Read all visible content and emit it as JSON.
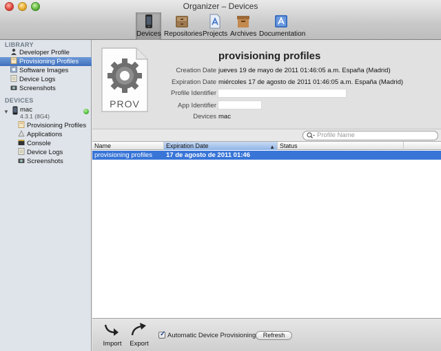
{
  "window": {
    "title": "Organizer – Devices"
  },
  "toolbar": {
    "items": [
      {
        "label": "Devices",
        "icon": "iphone-icon",
        "selected": true
      },
      {
        "label": "Repositories",
        "icon": "repository-icon",
        "selected": false
      },
      {
        "label": "Projects",
        "icon": "projects-icon",
        "selected": false
      },
      {
        "label": "Archives",
        "icon": "archive-icon",
        "selected": false
      },
      {
        "label": "Documentation",
        "icon": "documentation-icon",
        "selected": false
      }
    ]
  },
  "sidebar": {
    "library_heading": "LIBRARY",
    "library_items": [
      {
        "label": "Developer Profile",
        "icon": "person-icon"
      },
      {
        "label": "Provisioning Profiles",
        "icon": "profile-icon",
        "selected": true
      },
      {
        "label": "Software Images",
        "icon": "software-images-icon"
      },
      {
        "label": "Device Logs",
        "icon": "device-logs-icon"
      },
      {
        "label": "Screenshots",
        "icon": "camera-icon"
      }
    ],
    "devices_heading": "DEVICES",
    "device": {
      "name": "mac",
      "version": "4.3.1 (8G4)",
      "status_color": "#47b233"
    },
    "device_items": [
      {
        "label": "Provisioning Profiles",
        "icon": "profile-icon"
      },
      {
        "label": "Applications",
        "icon": "applications-icon"
      },
      {
        "label": "Console",
        "icon": "console-icon"
      },
      {
        "label": "Device Logs",
        "icon": "device-logs-icon"
      },
      {
        "label": "Screenshots",
        "icon": "camera-icon"
      }
    ]
  },
  "profile": {
    "title": "provisioning profiles",
    "icon_label": "PROV",
    "creation_label": "Creation Date",
    "creation_value": "jueves 19 de mayo de 2011 01:46:05 a.m. España (Madrid)",
    "expiration_label": "Expiration Date",
    "expiration_value": "miércoles 17 de agosto de 2011 01:46:05 a.m. España (Madrid)",
    "identifier_label": "Profile Identifier",
    "identifier_value": "",
    "app_id_label": "App Identifier",
    "app_id_value": "",
    "devices_label": "Devices",
    "devices_value": "mac"
  },
  "search": {
    "placeholder": "Profile Name"
  },
  "table": {
    "columns": [
      "Name",
      "Expiration Date",
      "Status"
    ],
    "sorted_column": "Expiration Date",
    "rows": [
      {
        "name": "provisioning profiles",
        "expiration": "17 de agosto de 2011 01:46",
        "status": ""
      }
    ]
  },
  "bottom": {
    "import_label": "Import",
    "export_label": "Export",
    "auto_provisioning_label": "Automatic Device Provisioning",
    "auto_provisioning_checked": true,
    "refresh_label": "Refresh"
  }
}
